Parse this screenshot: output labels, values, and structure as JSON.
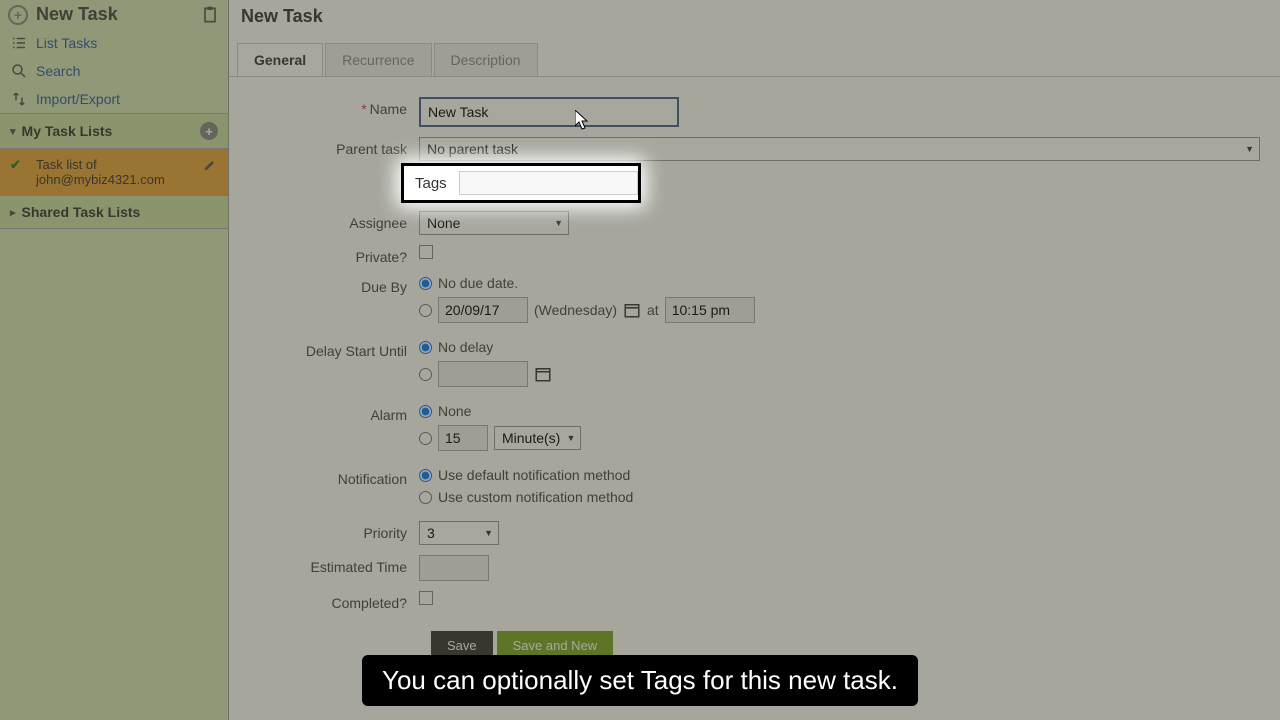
{
  "sidebar": {
    "header": "New Task",
    "nav": [
      {
        "label": "List Tasks",
        "icon": "list-icon"
      },
      {
        "label": "Search",
        "icon": "search-icon"
      },
      {
        "label": "Import/Export",
        "icon": "import-export-icon"
      }
    ],
    "section_my": "My Task Lists",
    "tasklist": {
      "line1": "Task list of",
      "line2": "john@mybiz4321.com"
    },
    "section_shared": "Shared Task Lists"
  },
  "page_title": "New Task",
  "tabs": [
    {
      "label": "General",
      "active": true
    },
    {
      "label": "Recurrence",
      "active": false
    },
    {
      "label": "Description",
      "active": false
    }
  ],
  "form": {
    "name_label": "Name",
    "name_value": "New Task",
    "parent_label": "Parent task",
    "parent_value": "No parent task",
    "tags_label": "Tags",
    "tags_value": "",
    "assignee_label": "Assignee",
    "assignee_value": "None",
    "private_label": "Private?",
    "dueby_label": "Due By",
    "dueby_nodue": "No due date.",
    "dueby_date": "20/09/17",
    "dueby_dayname": "(Wednesday)",
    "dueby_at": "at",
    "dueby_time": "10:15 pm",
    "delay_label": "Delay Start Until",
    "delay_none": "No delay",
    "delay_date": "",
    "alarm_label": "Alarm",
    "alarm_none": "None",
    "alarm_val": "15",
    "alarm_unit": "Minute(s)",
    "notif_label": "Notification",
    "notif_default": "Use default notification method",
    "notif_custom": "Use custom notification method",
    "priority_label": "Priority",
    "priority_value": "3",
    "est_label": "Estimated Time",
    "est_value": "",
    "completed_label": "Completed?",
    "save": "Save",
    "save_new": "Save and New"
  },
  "caption": "You can optionally set Tags for this new task."
}
